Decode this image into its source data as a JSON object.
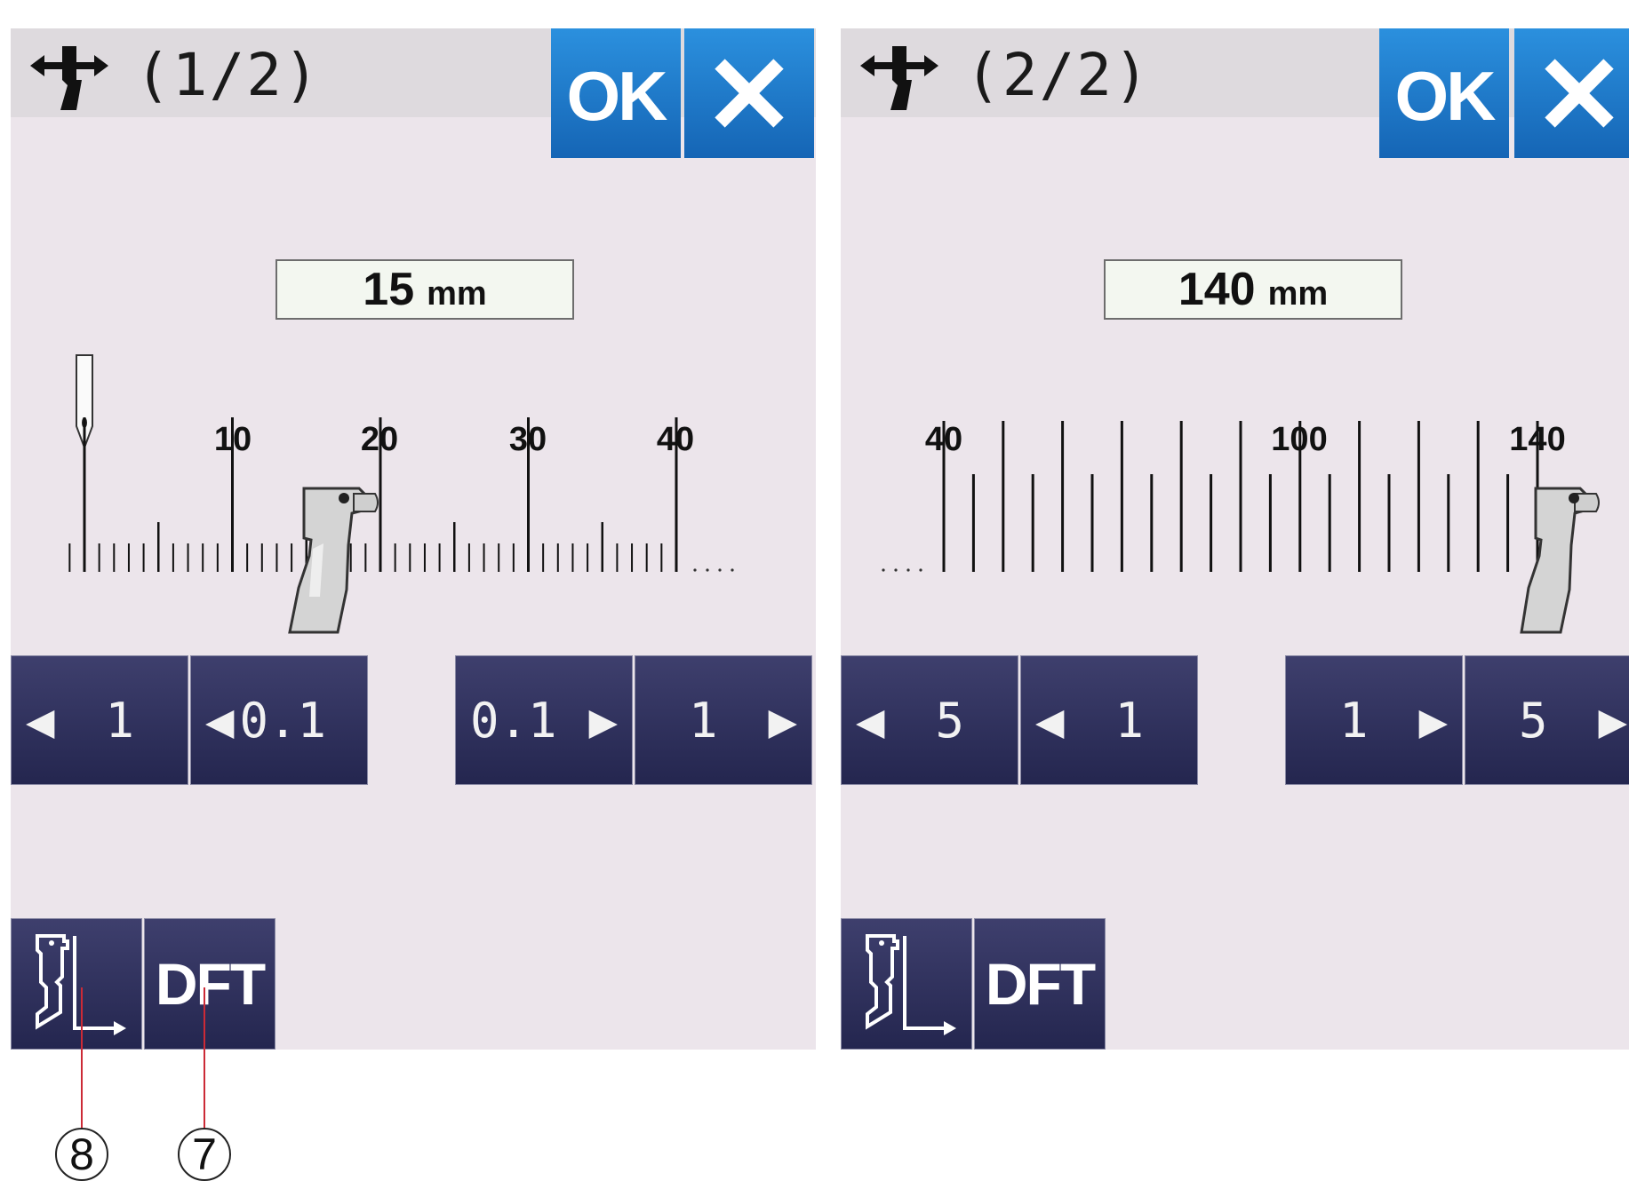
{
  "panel1": {
    "title": "(1/2)",
    "ok_label": "OK",
    "value": "15",
    "unit": "mm",
    "ruler_labels": [
      "10",
      "20",
      "30",
      "40"
    ],
    "buttons": [
      {
        "left_arrow": "◀",
        "label": "1"
      },
      {
        "left_arrow": "◀",
        "label": "0.1"
      },
      {
        "label": "0.1",
        "right_arrow": "▶"
      },
      {
        "label": "1",
        "right_arrow": "▶"
      }
    ],
    "dft_label": "DFT"
  },
  "panel2": {
    "title": "(2/2)",
    "ok_label": "OK",
    "value": "140",
    "unit": "mm",
    "ruler_labels": [
      "40",
      "100",
      "140"
    ],
    "buttons": [
      {
        "left_arrow": "◀",
        "label": "5"
      },
      {
        "left_arrow": "◀",
        "label": "1"
      },
      {
        "label": "1",
        "right_arrow": "▶"
      },
      {
        "label": "5",
        "right_arrow": "▶"
      }
    ],
    "dft_label": "DFT"
  },
  "callouts": {
    "seven": "7",
    "eight": "8"
  },
  "colors": {
    "ok_blue": "#1f7bcc",
    "button_navy": "#2d2f5c",
    "panel_bg": "#ece5eb",
    "callout_line": "#cc2a36"
  },
  "icons": [
    "presser-foot-arrow-icon",
    "close-icon",
    "needle-icon",
    "presser-foot-icon",
    "foot-shift-icon"
  ]
}
